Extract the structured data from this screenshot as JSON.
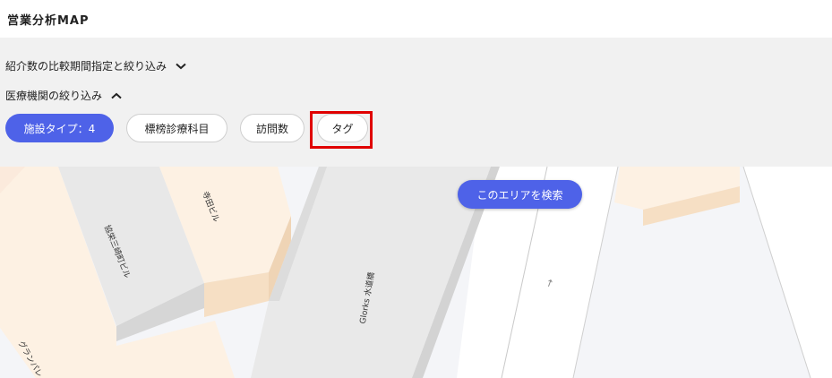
{
  "header": {
    "title": "営業分析MAP"
  },
  "filters": {
    "referral_toggle": {
      "label": "紹介数の比較期間指定と絞り込み",
      "icon": "chevron-down-icon"
    },
    "medical_toggle": {
      "label": "医療機関の絞り込み",
      "icon": "chevron-up-icon"
    },
    "chips": [
      {
        "label": "施設タイプ：4",
        "active": true
      },
      {
        "label": "標榜診療科目",
        "active": false
      },
      {
        "label": "訪問数",
        "active": false
      },
      {
        "label": "タグ",
        "active": false,
        "highlighted": true
      }
    ]
  },
  "map": {
    "search_button": "このエリアを検索",
    "building_labels": [
      "寺田ビル",
      "協栄三崎町ビル",
      "Glorks 水道橋",
      "グランパレ"
    ],
    "arrow_glyph": "↑"
  },
  "colors": {
    "accent": "#4e62e8",
    "highlight": "#e00000",
    "panel_bg": "#f1f1f1",
    "building_peach": "#fdf1e3",
    "building_gray": "#e8e8e8"
  }
}
